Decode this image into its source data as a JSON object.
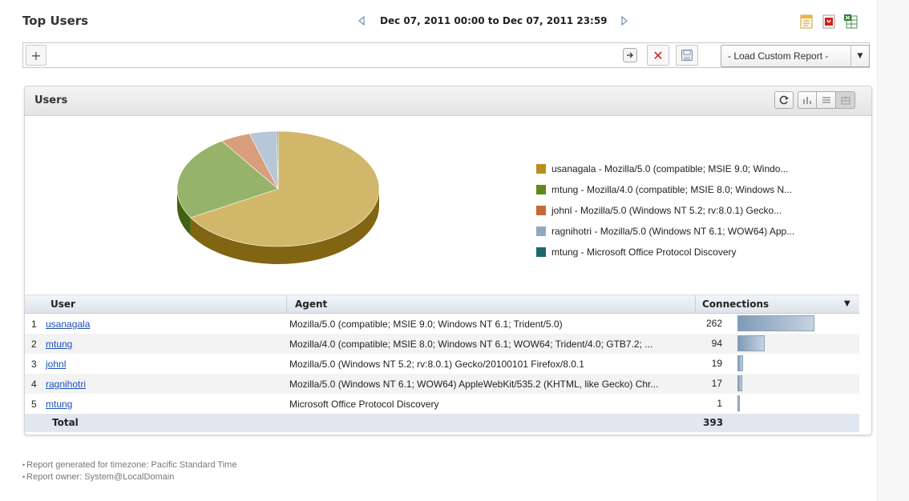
{
  "header": {
    "title": "Top Users",
    "date_range": "Dec 07, 2011 00:00 to Dec 07, 2011 23:59",
    "export_icons": [
      "report-icon",
      "pdf-icon",
      "excel-icon"
    ]
  },
  "filter_bar": {
    "add_label": "+",
    "input_value": "",
    "report_select": "- Load Custom Report -"
  },
  "panel": {
    "title": "Users",
    "tools": [
      "refresh-icon",
      "bar-chart-icon",
      "list-icon",
      "pie-chart-icon"
    ]
  },
  "chart_data": {
    "type": "pie",
    "title": "",
    "legend_position": "right",
    "slices": [
      {
        "label": "usanagala - Mozilla/5.0 (compatible; MSIE 9.0; Windo...",
        "value": 262,
        "color": "#b8901a"
      },
      {
        "label": "mtung - Mozilla/4.0 (compatible; MSIE 8.0; Windows N...",
        "value": 94,
        "color": "#5e8a18"
      },
      {
        "label": "johnl - Mozilla/5.0 (Windows NT 5.2; rv:8.0.1) Gecko...",
        "value": 19,
        "color": "#c46a36"
      },
      {
        "label": "ragnihotri - Mozilla/5.0 (Windows NT 6.1; WOW64) App...",
        "value": 17,
        "color": "#8fa9c2"
      },
      {
        "label": "mtung - Microsoft Office Protocol Discovery",
        "value": 1,
        "color": "#1a6a6a"
      }
    ]
  },
  "table": {
    "columns": {
      "user": "User",
      "agent": "Agent",
      "connections": "Connections"
    },
    "max_connections": 262,
    "rows": [
      {
        "num": "1",
        "user": "usanagala",
        "agent": "Mozilla/5.0 (compatible; MSIE 9.0; Windows NT 6.1; Trident/5.0)",
        "connections": "262"
      },
      {
        "num": "2",
        "user": "mtung",
        "agent": "Mozilla/4.0 (compatible; MSIE 8.0; Windows NT 6.1; WOW64; Trident/4.0; GTB7.2; ...",
        "connections": "94"
      },
      {
        "num": "3",
        "user": "johnl",
        "agent": "Mozilla/5.0 (Windows NT 5.2; rv:8.0.1) Gecko/20100101 Firefox/8.0.1",
        "connections": "19"
      },
      {
        "num": "4",
        "user": "ragnihotri",
        "agent": "Mozilla/5.0 (Windows NT 6.1; WOW64) AppleWebKit/535.2 (KHTML, like Gecko) Chr...",
        "connections": "17"
      },
      {
        "num": "5",
        "user": "mtung",
        "agent": "Microsoft Office Protocol Discovery",
        "connections": "1"
      }
    ],
    "total_label": "Total",
    "total_value": "393"
  },
  "footer": {
    "timezone": "Report generated for timezone: Pacific Standard Time",
    "owner": "Report owner: System@LocalDomain"
  }
}
